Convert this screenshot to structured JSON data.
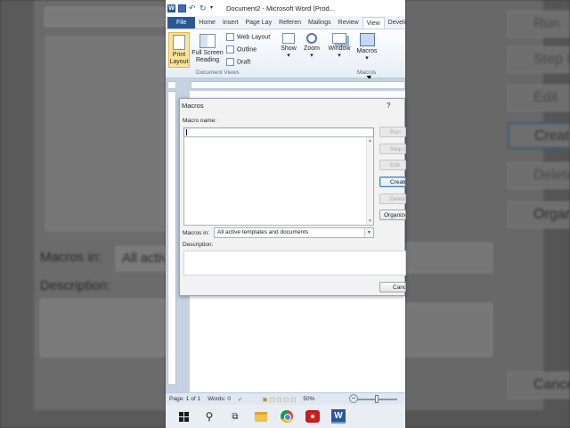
{
  "background": {
    "macros_in_label": "Macros in:",
    "macros_in_value": "All activ",
    "description_label": "Description:",
    "buttons": [
      "Run",
      "Step Into",
      "Edit",
      "Create",
      "Delete",
      "Organize...",
      "Cancel"
    ]
  },
  "window": {
    "title": "Document2 - Microsoft Word (Prod...",
    "tabs": [
      "File",
      "Home",
      "Insert",
      "Page Lay",
      "Referen",
      "Mailings",
      "Review",
      "View",
      "Develo"
    ],
    "active_tab": "View"
  },
  "ribbon": {
    "print_layout": "Print Layout",
    "full_screen_reading": "Full Screen Reading",
    "web_layout": "Web Layout",
    "outline": "Outline",
    "draft": "Draft",
    "document_views": "Document Views",
    "show": "Show",
    "zoom": "Zoom",
    "window": "Window",
    "macros": "Macros",
    "macros_group": "Macros"
  },
  "status": {
    "page": "Page: 1 of 1",
    "words": "Words: 0",
    "zoom": "50%"
  },
  "dialog": {
    "title": "Macros",
    "help": "?",
    "macro_name_label": "Macro name:",
    "macro_name_value": "",
    "macros_in_label": "Macros in:",
    "macros_in_value": "All active templates and documents",
    "description_label": "Description:",
    "buttons": {
      "run": "Run",
      "step_into": "Step Into",
      "edit": "Edit",
      "create": "Create",
      "delete": "Delete",
      "organizer": "Organizer...",
      "cancel": "Cancel"
    }
  }
}
